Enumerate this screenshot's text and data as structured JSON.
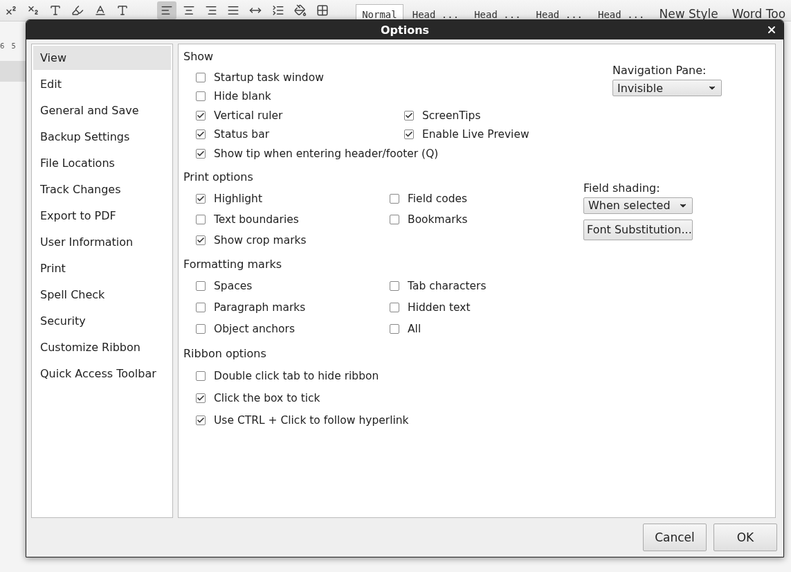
{
  "app": {
    "ruler": [
      "6",
      "5"
    ],
    "styles": [
      {
        "label": "Normal",
        "selected": true
      },
      {
        "label": "Head ...",
        "selected": false
      },
      {
        "label": "Head ...",
        "selected": false
      },
      {
        "label": "Head ...",
        "selected": false
      },
      {
        "label": "Head ...",
        "selected": false
      }
    ],
    "new_style": "New Style",
    "word_tools": "Word Too"
  },
  "dialog": {
    "title": "Options",
    "sidebar": [
      {
        "label": "View",
        "selected": true
      },
      {
        "label": "Edit",
        "selected": false
      },
      {
        "label": "General and Save",
        "selected": false
      },
      {
        "label": "Backup Settings",
        "selected": false
      },
      {
        "label": "File Locations",
        "selected": false
      },
      {
        "label": "Track Changes",
        "selected": false
      },
      {
        "label": "Export to PDF",
        "selected": false
      },
      {
        "label": "User Information",
        "selected": false
      },
      {
        "label": "Print",
        "selected": false
      },
      {
        "label": "Spell Check",
        "selected": false
      },
      {
        "label": "Security",
        "selected": false
      },
      {
        "label": "Customize Ribbon",
        "selected": false
      },
      {
        "label": "Quick Access Toolbar",
        "selected": false
      }
    ],
    "sections": [
      {
        "title": "Show",
        "rows": [
          [
            {
              "label": "Startup task window",
              "checked": false
            }
          ],
          [
            {
              "label": "Hide blank",
              "checked": false
            }
          ],
          [
            {
              "label": "Vertical ruler",
              "checked": true
            },
            {
              "label": "ScreenTips",
              "checked": true
            }
          ],
          [
            {
              "label": "Status bar",
              "checked": true
            },
            {
              "label": "Enable Live Preview",
              "checked": true
            }
          ],
          [
            {
              "label": "Show tip when entering header/footer (Q)",
              "checked": true
            }
          ]
        ],
        "side": {
          "label": "Navigation Pane:",
          "dropdown": "Invisible"
        }
      },
      {
        "title": "Print options",
        "rows": [
          [
            {
              "label": "Highlight",
              "checked": true
            },
            {
              "label": "Field codes",
              "checked": false
            }
          ],
          [
            {
              "label": "Text boundaries",
              "checked": false
            },
            {
              "label": "Bookmarks",
              "checked": false
            }
          ],
          [
            {
              "label": "Show crop marks",
              "checked": true
            }
          ]
        ],
        "side": {
          "label": "Field shading:",
          "dropdown": "When selected",
          "button": "Font Substitution..."
        }
      },
      {
        "title": "Formatting marks",
        "rows": [
          [
            {
              "label": "Spaces",
              "checked": false
            },
            {
              "label": "Tab characters",
              "checked": false
            }
          ],
          [
            {
              "label": "Paragraph marks",
              "checked": false
            },
            {
              "label": "Hidden text",
              "checked": false
            }
          ],
          [
            {
              "label": "Object anchors",
              "checked": false
            },
            {
              "label": "All",
              "checked": false
            }
          ]
        ]
      },
      {
        "title": "Ribbon options",
        "rows": [
          [
            {
              "label": "Double click tab to hide ribbon",
              "checked": false
            }
          ],
          [
            {
              "label": "Click the box to tick",
              "checked": true
            }
          ],
          [
            {
              "label": "Use CTRL + Click to follow hyperlink",
              "checked": true
            }
          ]
        ]
      }
    ],
    "buttons": [
      "Cancel",
      "OK"
    ]
  }
}
